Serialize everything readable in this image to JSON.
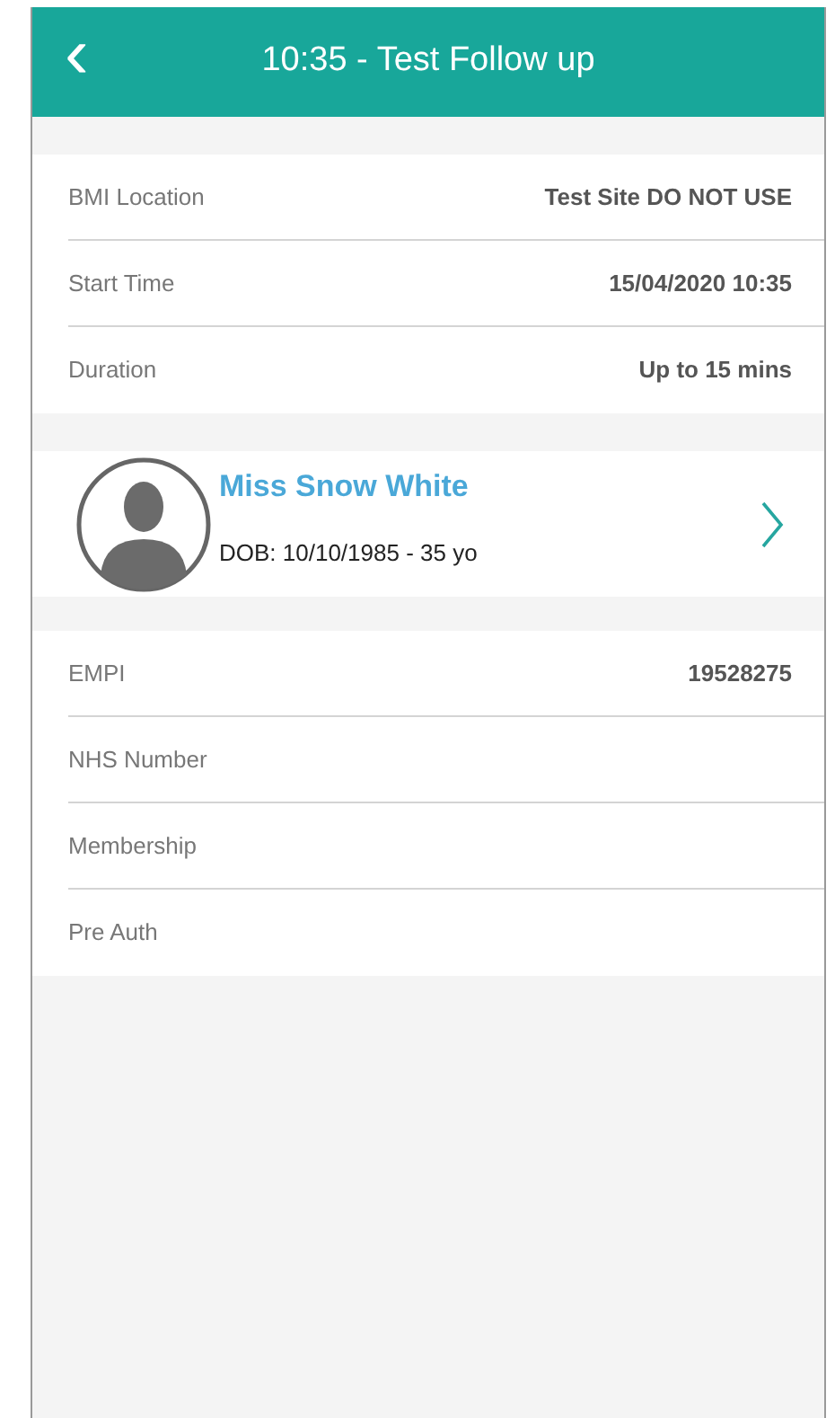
{
  "header": {
    "back_icon": "‹",
    "title": "10:35 - Test Follow up"
  },
  "appointment": [
    {
      "label": "BMI Location",
      "value": "Test Site DO NOT USE"
    },
    {
      "label": "Start Time",
      "value": "15/04/2020 10:35"
    },
    {
      "label": "Duration",
      "value": "Up to 15 mins"
    }
  ],
  "patient": {
    "name": "Miss Snow White",
    "dob": "DOB: 10/10/1985 - 35 yo"
  },
  "details": [
    {
      "label": "EMPI",
      "value": "19528275"
    },
    {
      "label": "NHS Number"
    },
    {
      "label": "Membership"
    },
    {
      "label": "Pre Auth"
    }
  ]
}
